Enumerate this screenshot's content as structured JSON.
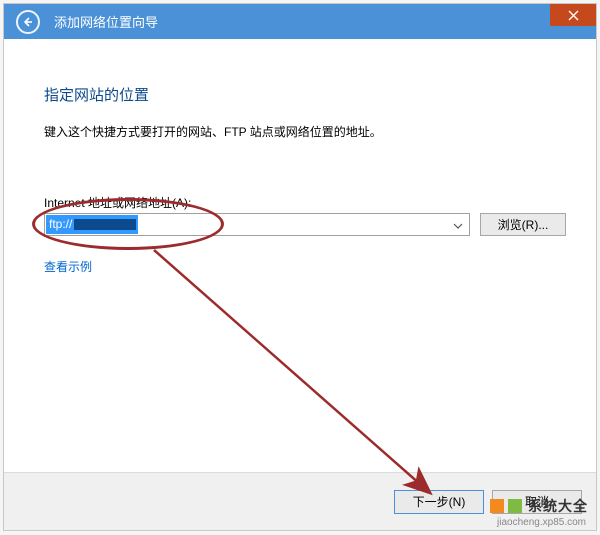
{
  "titlebar": {
    "title": "添加网络位置向导"
  },
  "content": {
    "heading": "指定网站的位置",
    "description": "键入这个快捷方式要打开的网站、FTP 站点或网络位置的地址。",
    "field_label": "Internet 地址或网络地址(A):",
    "input_prefix": "ftp://",
    "browse_label": "浏览(R)...",
    "examples_label": "查看示例"
  },
  "footer": {
    "next_label": "下一步(N)",
    "cancel_label": "取消"
  },
  "watermark": {
    "main": "系统大全",
    "sub": "jiaocheng.xp85.com"
  }
}
